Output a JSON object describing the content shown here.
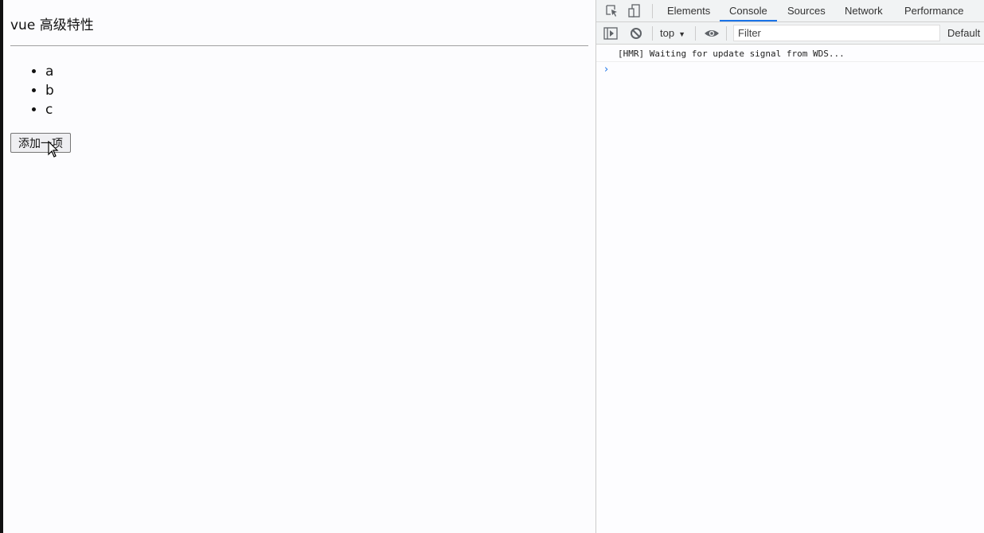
{
  "page": {
    "title": "vue 高级特性",
    "list_items": [
      "a",
      "b",
      "c"
    ],
    "add_button_label": "添加一项"
  },
  "devtools": {
    "tabs": [
      {
        "label": "Elements",
        "active": false
      },
      {
        "label": "Console",
        "active": true
      },
      {
        "label": "Sources",
        "active": false
      },
      {
        "label": "Network",
        "active": false
      },
      {
        "label": "Performance",
        "active": false
      }
    ],
    "toolbar": {
      "context": "top",
      "filter_placeholder": "Filter",
      "levels_label": "Default"
    },
    "console": {
      "messages": [
        "[HMR] Waiting for update signal from WDS..."
      ],
      "prompt_symbol": "›"
    },
    "colors": {
      "accent": "#1a73e8"
    }
  }
}
